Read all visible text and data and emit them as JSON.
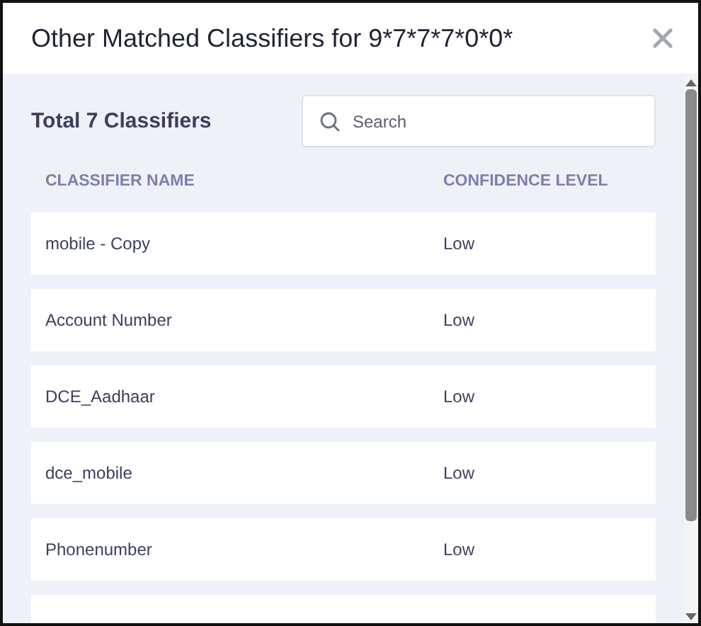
{
  "dialog": {
    "title": "Other Matched Classifiers for 9*7*7*7*0*0*"
  },
  "summary": {
    "total": "Total 7 Classifiers"
  },
  "search": {
    "placeholder": "Search"
  },
  "table": {
    "columns": [
      "CLASSIFIER NAME",
      "CONFIDENCE LEVEL"
    ],
    "rows": [
      {
        "name": "mobile - Copy",
        "confidence": "Low"
      },
      {
        "name": "Account Number",
        "confidence": "Low"
      },
      {
        "name": "DCE_Aadhaar",
        "confidence": "Low"
      },
      {
        "name": "dce_mobile",
        "confidence": "Low"
      },
      {
        "name": "Phonenumber",
        "confidence": "Low"
      }
    ]
  }
}
